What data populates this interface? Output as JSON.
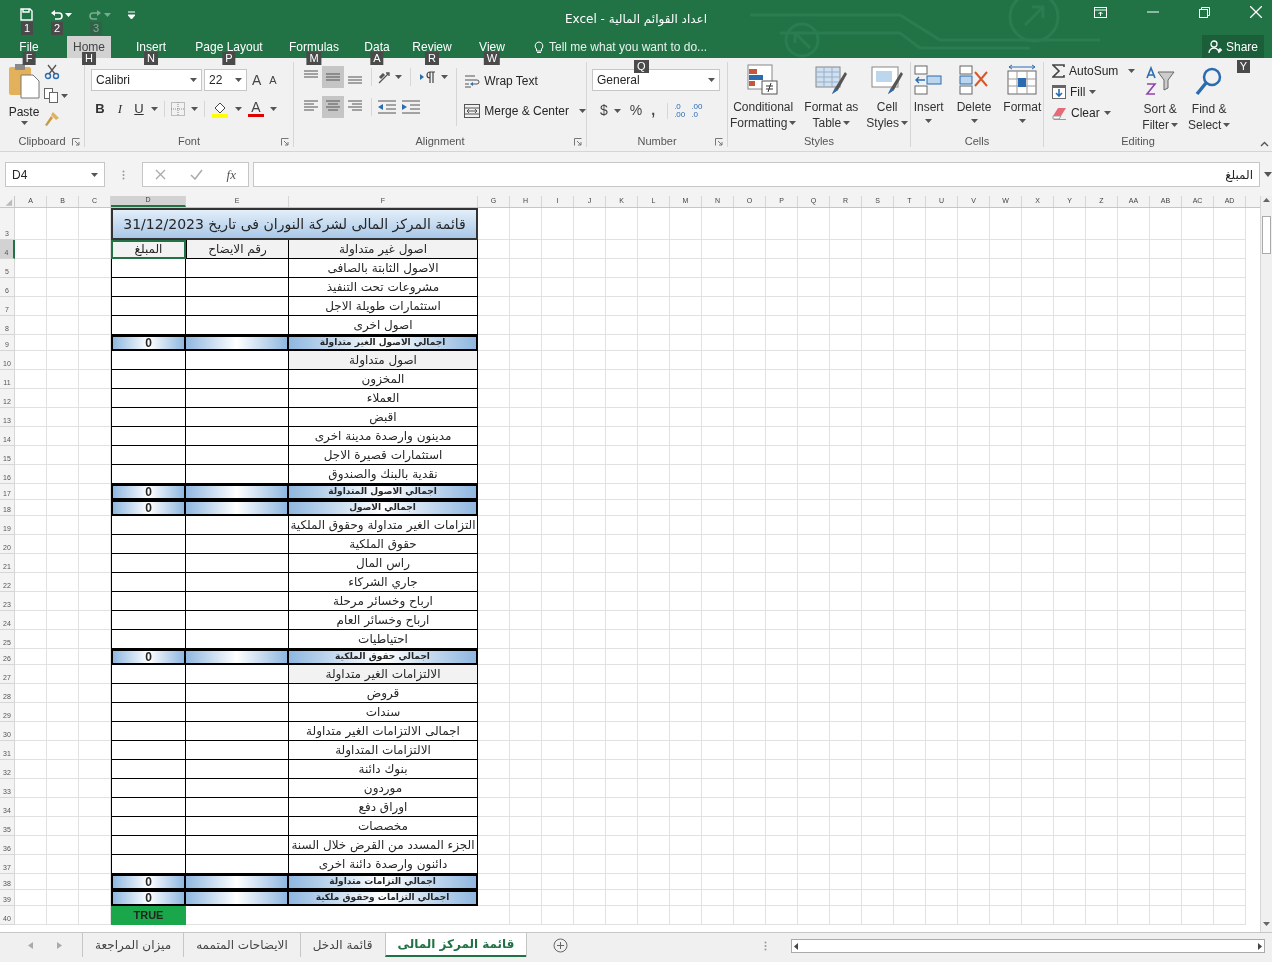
{
  "title_bar": {
    "title": "اعداد القوائم المالية - Excel",
    "quick_access": [
      {
        "kind": "redo",
        "keytip": "3",
        "disabled": true
      },
      {
        "kind": "undo",
        "keytip": "2",
        "disabled": false
      },
      {
        "kind": "save",
        "keytip": "1",
        "disabled": false
      }
    ]
  },
  "ribbon_tabs": [
    {
      "label": "View",
      "keytip": "W",
      "selected": false
    },
    {
      "label": "Review",
      "keytip": "R",
      "selected": false
    },
    {
      "label": "Data",
      "keytip": "A",
      "selected": false
    },
    {
      "label": "Formulas",
      "keytip": "M",
      "selected": false
    },
    {
      "label": "Page Layout",
      "keytip": "P",
      "selected": false
    },
    {
      "label": "Insert",
      "keytip": "N",
      "selected": false
    },
    {
      "label": "Home",
      "keytip": "H",
      "selected": true
    },
    {
      "label": "File",
      "keytip": "F",
      "selected": false
    }
  ],
  "tell_me": {
    "placeholder": "Tell me what you want to do...",
    "keytip": "Q"
  },
  "share": {
    "label": "Share",
    "keytip": "Y"
  },
  "ribbon": {
    "clipboard": {
      "label": "Clipboard",
      "paste": "Paste"
    },
    "font": {
      "label": "Font",
      "font_name": "Calibri",
      "font_size": "22",
      "grow": "A",
      "shrink": "A",
      "bold": "B",
      "italic": "I",
      "underline": "U",
      "font_color": "A"
    },
    "alignment": {
      "label": "Alignment",
      "vertical": [
        {
          "selected": false
        },
        {
          "selected": true
        },
        {
          "selected": false
        }
      ],
      "horizontal": [
        {
          "selected": false
        },
        {
          "selected": true
        },
        {
          "selected": false
        }
      ],
      "wrap_text": "Wrap Text",
      "merge": "Merge & Center"
    },
    "number": {
      "label": "Number",
      "format": "General",
      "currency": "$",
      "percent": "%",
      "comma": ",",
      "increase_decimal": [
        ".0",
        ".00"
      ],
      "decrease_decimal": [
        ".00",
        ".0"
      ]
    },
    "styles": {
      "label": "Styles",
      "buttons": [
        {
          "kind": "cellstyles",
          "lines": [
            "Cell",
            "Styles"
          ]
        },
        {
          "kind": "table",
          "lines": [
            "Format as",
            "Table"
          ]
        },
        {
          "kind": "conditional",
          "lines": [
            "Conditional",
            "Formatting"
          ]
        }
      ]
    },
    "cells": {
      "label": "Cells",
      "buttons": [
        {
          "kind": "format",
          "lines": [
            "Format"
          ]
        },
        {
          "kind": "delete",
          "lines": [
            "Delete"
          ]
        },
        {
          "kind": "insert",
          "lines": [
            "Insert"
          ]
        }
      ]
    },
    "editing": {
      "label": "Editing",
      "autosum": "AutoSum",
      "fill": "Fill",
      "clear": "Clear",
      "buttons": [
        {
          "kind": "find",
          "lines": [
            "Find &",
            "Select"
          ]
        },
        {
          "kind": "sort",
          "lines": [
            "Sort &",
            "Filter"
          ]
        }
      ]
    }
  },
  "formula_bar": {
    "name_box": "D4",
    "fx": "fx",
    "value": "المبلغ"
  },
  "columns": [
    {
      "label": "AD",
      "selected": false
    },
    {
      "label": "AC",
      "selected": false
    },
    {
      "label": "AB",
      "selected": false
    },
    {
      "label": "AA",
      "selected": false
    },
    {
      "label": "Z",
      "selected": false
    },
    {
      "label": "Y",
      "selected": false
    },
    {
      "label": "X",
      "selected": false
    },
    {
      "label": "W",
      "selected": false
    },
    {
      "label": "V",
      "selected": false
    },
    {
      "label": "U",
      "selected": false
    },
    {
      "label": "T",
      "selected": false
    },
    {
      "label": "S",
      "selected": false
    },
    {
      "label": "R",
      "selected": false
    },
    {
      "label": "Q",
      "selected": false
    },
    {
      "label": "P",
      "selected": false
    },
    {
      "label": "O",
      "selected": false
    },
    {
      "label": "N",
      "selected": false
    },
    {
      "label": "M",
      "selected": false
    },
    {
      "label": "L",
      "selected": false
    },
    {
      "label": "K",
      "selected": false
    },
    {
      "label": "J",
      "selected": false
    },
    {
      "label": "I",
      "selected": false
    },
    {
      "label": "H",
      "selected": false
    },
    {
      "label": "G",
      "selected": false
    },
    {
      "label": "F",
      "selected": false
    },
    {
      "label": "E",
      "selected": false
    },
    {
      "label": "D",
      "selected": true
    },
    {
      "label": "C",
      "selected": false
    },
    {
      "label": "B",
      "selected": false
    },
    {
      "label": "A",
      "selected": false
    }
  ],
  "rows": [
    {
      "n": "3",
      "kind": "title",
      "selected": false,
      "label": "قائمة المركز المالى لشركة النوران فى تاريخ 31/12/2023"
    },
    {
      "n": "4",
      "kind": "header",
      "selected": true,
      "amount": "المبلغ",
      "note": "رقم الايضاح",
      "label": "اصول غير متداولة"
    },
    {
      "n": "5",
      "kind": "item",
      "selected": false,
      "label": "الاصول الثابتة بالصافى"
    },
    {
      "n": "6",
      "kind": "item",
      "selected": false,
      "label": "مشروعات تحت التنفيذ"
    },
    {
      "n": "7",
      "kind": "item",
      "selected": false,
      "label": "استثمارات طويلة الاجل"
    },
    {
      "n": "8",
      "kind": "item",
      "selected": false,
      "label": "اصول اخرى"
    },
    {
      "n": "9",
      "kind": "total",
      "selected": false,
      "amount": "0",
      "label": "اجمالي الاصول الغير متداولة"
    },
    {
      "n": "10",
      "kind": "section",
      "selected": false,
      "label": "اصول متداولة"
    },
    {
      "n": "11",
      "kind": "item",
      "selected": false,
      "label": "المخزون"
    },
    {
      "n": "12",
      "kind": "item",
      "selected": false,
      "label": "العملاء"
    },
    {
      "n": "13",
      "kind": "item",
      "selected": false,
      "label": "اقبض"
    },
    {
      "n": "14",
      "kind": "item",
      "selected": false,
      "label": "مدينون وارصدة مدينة اخرى"
    },
    {
      "n": "15",
      "kind": "item",
      "selected": false,
      "label": "استثمارات قصيرة الاجل"
    },
    {
      "n": "16",
      "kind": "item",
      "selected": false,
      "label": "نقدية بالبنك والصندوق"
    },
    {
      "n": "17",
      "kind": "total",
      "selected": false,
      "amount": "0",
      "label": "اجمالي الاصول المتداولة"
    },
    {
      "n": "18",
      "kind": "total",
      "selected": false,
      "amount": "0",
      "label": "اجمالي الاصول"
    },
    {
      "n": "19",
      "kind": "item",
      "selected": false,
      "label": "التزامات الغير متداولة وحقوق الملكية"
    },
    {
      "n": "20",
      "kind": "item",
      "selected": false,
      "label": "حقوق الملكية"
    },
    {
      "n": "21",
      "kind": "item",
      "selected": false,
      "label": "راس المال"
    },
    {
      "n": "22",
      "kind": "item",
      "selected": false,
      "label": "جاري الشركاء"
    },
    {
      "n": "23",
      "kind": "item",
      "selected": false,
      "label": "ارباح وخسائر مرحلة"
    },
    {
      "n": "24",
      "kind": "item",
      "selected": false,
      "label": "ارباح وخسائر العام"
    },
    {
      "n": "25",
      "kind": "item",
      "selected": false,
      "label": "احتياطيات"
    },
    {
      "n": "26",
      "kind": "total",
      "selected": false,
      "amount": "0",
      "label": "اجمالي حقوق الملكية"
    },
    {
      "n": "27",
      "kind": "section",
      "selected": false,
      "label": "الالتزامات الغير متداولة"
    },
    {
      "n": "28",
      "kind": "item",
      "selected": false,
      "label": "قروض"
    },
    {
      "n": "29",
      "kind": "item",
      "selected": false,
      "label": "سندات"
    },
    {
      "n": "30",
      "kind": "item",
      "selected": false,
      "label": "اجمالى الالتزامات الغير متداولة"
    },
    {
      "n": "31",
      "kind": "item",
      "selected": false,
      "label": "الالتزامات المتداولة"
    },
    {
      "n": "32",
      "kind": "item",
      "selected": false,
      "label": "بنوك دائنة"
    },
    {
      "n": "33",
      "kind": "item",
      "selected": false,
      "label": "موردون"
    },
    {
      "n": "34",
      "kind": "item",
      "selected": false,
      "label": "اوراق دفع"
    },
    {
      "n": "35",
      "kind": "item",
      "selected": false,
      "label": "مخصصات"
    },
    {
      "n": "36",
      "kind": "item",
      "selected": false,
      "label": "الجزء المسدد من القرض خلال السنة"
    },
    {
      "n": "37",
      "kind": "item",
      "selected": false,
      "label": "دائنون وارصدة دائنة اخرى"
    },
    {
      "n": "38",
      "kind": "total",
      "selected": false,
      "amount": "0",
      "label": "اجمالي التزامات متداولة"
    },
    {
      "n": "39",
      "kind": "total",
      "selected": false,
      "amount": "0",
      "label": "اجمالي التزامات وحقوق ملكية"
    },
    {
      "n": "40",
      "kind": "check",
      "selected": false,
      "amount": "TRUE"
    }
  ],
  "sheet_tabs": [
    {
      "label": "قائمة المركز المالى",
      "selected": true
    },
    {
      "label": "قائمة الدخل",
      "selected": false
    },
    {
      "label": "الايضاحات المتممه",
      "selected": false
    },
    {
      "label": "ميزان المراجعة",
      "selected": false
    }
  ]
}
